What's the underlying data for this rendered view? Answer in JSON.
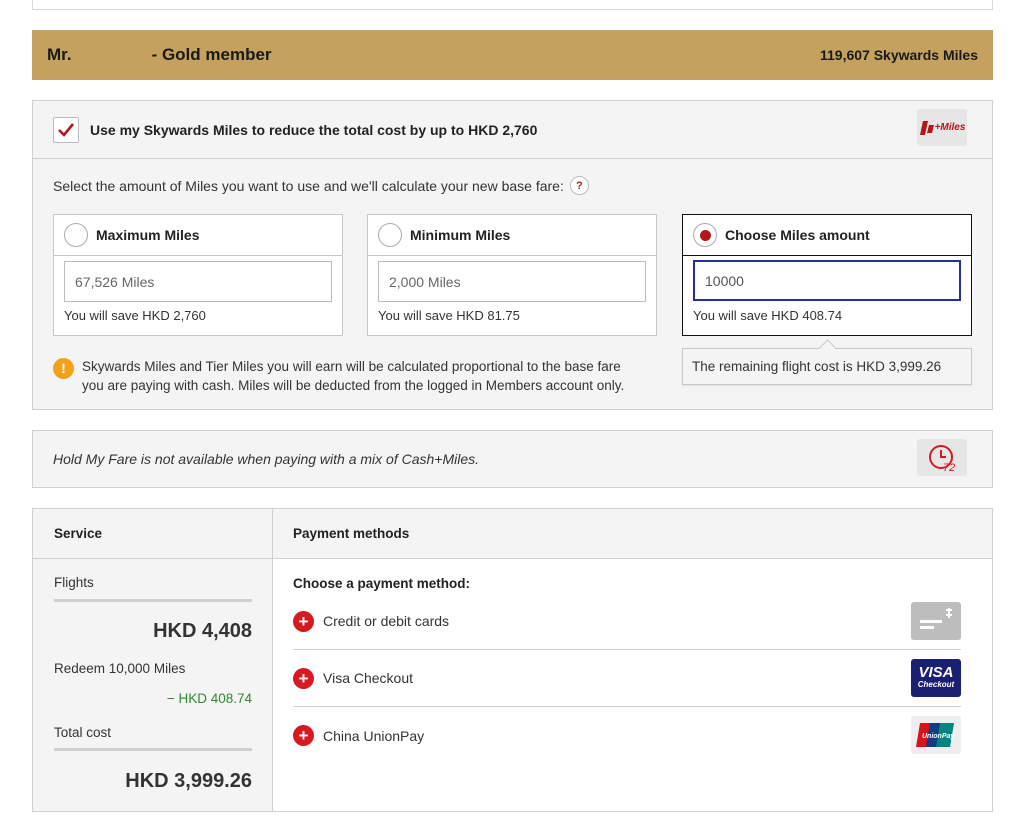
{
  "member": {
    "name_prefix": "Mr.",
    "tier": "- Gold member",
    "miles_balance": "119,607 Skywards Miles"
  },
  "use_miles": {
    "checked": true,
    "label": "Use my Skywards Miles to reduce the total cost by up to HKD 2,760",
    "logo_text": "+Miles",
    "prompt": "Select the amount of Miles you want to use and we'll calculate your new base fare:",
    "help_glyph": "?",
    "options": [
      {
        "title": "Maximum Miles",
        "value": "67,526 Miles",
        "save": "You will save HKD 2,760",
        "selected": false
      },
      {
        "title": "Minimum Miles",
        "value": "2,000 Miles",
        "save": "You will save HKD 81.75",
        "selected": false
      },
      {
        "title": "Choose Miles amount",
        "value": "10000",
        "save": "You will save HKD 408.74",
        "selected": true
      }
    ],
    "notice_glyph": "!",
    "notice_line1": "Skywards Miles and Tier Miles you will earn will be calculated proportional to the base fare",
    "notice_line2": "you are paying with cash. Miles will be deducted from the logged in Members account only.",
    "tooltip": "The remaining flight cost is HKD 3,999.26"
  },
  "hold": {
    "text": "Hold My Fare is not available when paying with a mix of Cash+Miles.",
    "icon_text": "72"
  },
  "payment": {
    "service_header": "Service",
    "methods_header": "Payment methods",
    "service": {
      "flights_label": "Flights",
      "flights_amount": "HKD 4,408",
      "redeem_label": "Redeem 10,000 Miles",
      "redeem_amount": "− HKD 408.74",
      "total_label": "Total cost",
      "total_amount": "HKD 3,999.26"
    },
    "choose_label": "Choose a payment method:",
    "methods": [
      {
        "name": "Credit or debit cards",
        "icon": "generic-card-icon"
      },
      {
        "name": "Visa Checkout",
        "icon": "visa-checkout-icon",
        "icon_text_1": "VISA",
        "icon_text_2": "Checkout"
      },
      {
        "name": "China UnionPay",
        "icon": "unionpay-icon",
        "icon_text": "UnionPay"
      }
    ],
    "plus_glyph": "+"
  },
  "colors": {
    "gold": "#c4a15e",
    "brand_red": "#d71921",
    "focus_blue": "#23319c",
    "discount_green": "#2d8a2d"
  }
}
